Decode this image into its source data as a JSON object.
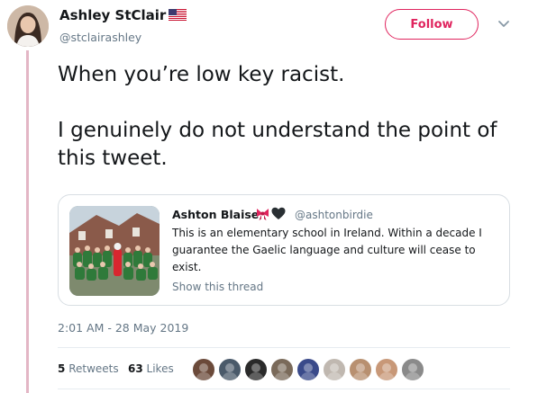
{
  "author": {
    "name": "Ashley StClair",
    "handle": "@stclairashley",
    "flag_icon": "us-flag-icon"
  },
  "follow_button": {
    "label": "Follow",
    "accent_color": "#e0245e"
  },
  "menu_icon": "chevron-down-icon",
  "tweet": {
    "paragraphs": [
      "When you’re low key racist.",
      "I genuinely do not understand the point of this tweet."
    ]
  },
  "quoted_tweet": {
    "name": "Ashton Blaise",
    "badge_icons": [
      "ribbon-bow-icon",
      "black-heart-icon"
    ],
    "handle": "@ashtonbirdie",
    "text": "This is an elementary school in Ireland. Within a decade I guarantee the Gaelic language and culture will cease to exist.",
    "show_thread_label": "Show this thread",
    "media_description": "group-photo-thumbnail"
  },
  "timestamp": "2:01 AM - 28 May 2019",
  "stats": {
    "retweets_count": "5",
    "retweets_label": "Retweets",
    "likes_count": "63",
    "likes_label": "Likes"
  },
  "liker_avatars": [
    {
      "name": "liker-avatar-1",
      "color": "#6b4a3a"
    },
    {
      "name": "liker-avatar-2",
      "color": "#4a5a6a"
    },
    {
      "name": "liker-avatar-3",
      "color": "#2a2a2a"
    },
    {
      "name": "liker-avatar-4",
      "color": "#7a6a5a"
    },
    {
      "name": "liker-avatar-5",
      "color": "#3a4a8a"
    },
    {
      "name": "liker-avatar-6",
      "color": "#c0b8b0"
    },
    {
      "name": "liker-avatar-7",
      "color": "#b89070"
    },
    {
      "name": "liker-avatar-8",
      "color": "#c89878"
    },
    {
      "name": "liker-avatar-9",
      "color": "#8a8a8a"
    }
  ],
  "colors": {
    "thread_line": "#e3b6c5",
    "secondary_text": "#657786",
    "primary_text": "#14171a",
    "border": "#d8dee3"
  }
}
